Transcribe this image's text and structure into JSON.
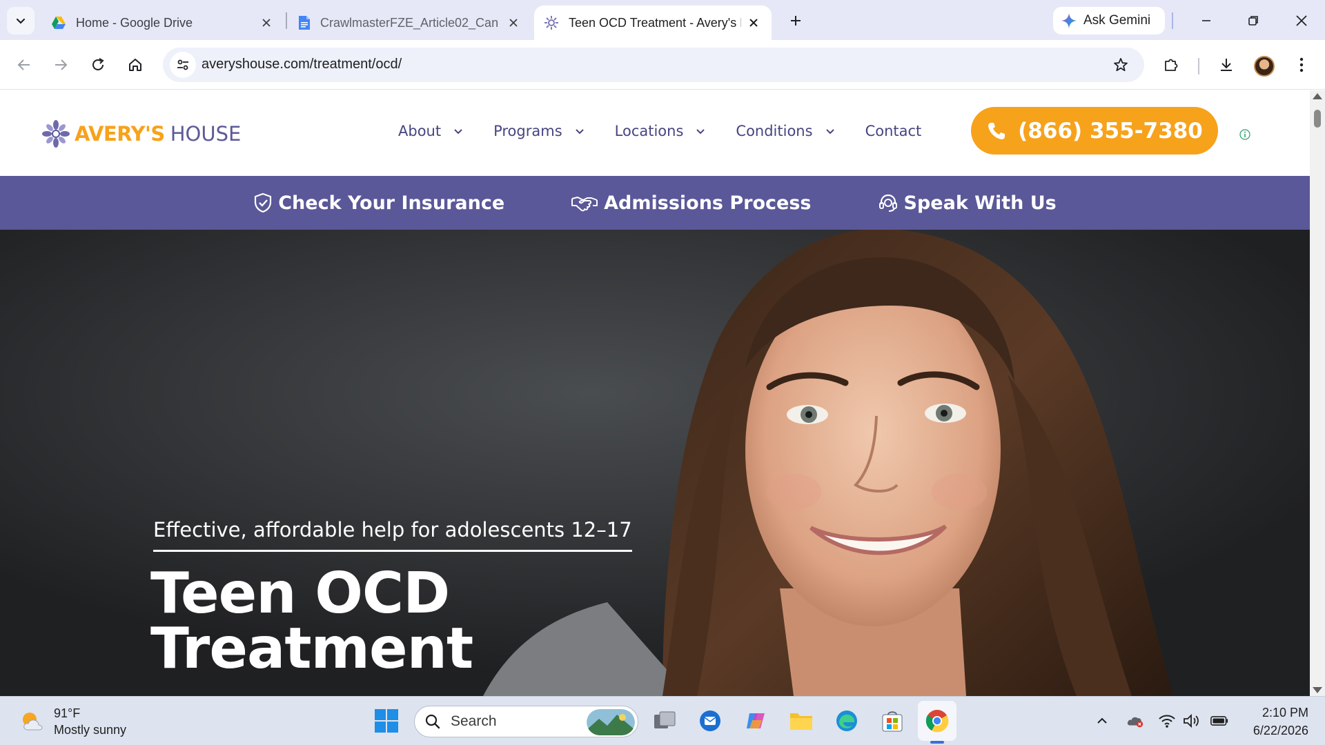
{
  "browser": {
    "tabs": [
      {
        "title": "Home - Google Drive",
        "icon": "google-drive-icon",
        "active": false
      },
      {
        "title": "CrawlmasterFZE_Article02_Can",
        "icon": "google-docs-icon",
        "active": false
      },
      {
        "title": "Teen OCD Treatment - Avery's H",
        "icon": "averys-house-favicon",
        "active": true
      }
    ],
    "ask_gemini_label": "Ask Gemini",
    "url": "averyshouse.com/treatment/ocd/"
  },
  "site": {
    "logo_word1": "AVERY'S",
    "logo_word2": "HOUSE",
    "nav": [
      {
        "label": "About",
        "dropdown": true
      },
      {
        "label": "Programs",
        "dropdown": true
      },
      {
        "label": "Locations",
        "dropdown": true
      },
      {
        "label": "Conditions",
        "dropdown": true
      },
      {
        "label": "Contact",
        "dropdown": false
      }
    ],
    "phone": "(866) 355-7380",
    "actions": [
      {
        "label": "Check Your Insurance",
        "icon": "shield-check-icon"
      },
      {
        "label": "Admissions Process",
        "icon": "handshake-icon"
      },
      {
        "label": "Speak With Us",
        "icon": "headset-icon"
      }
    ],
    "hero": {
      "tagline": "Effective, affordable help for adolescents 12–17",
      "title_line1": "Teen OCD",
      "title_line2": "Treatment"
    },
    "colors": {
      "accent": "#f7a21b",
      "brand_purple": "#5a5898",
      "nav_text": "#454580"
    }
  },
  "taskbar": {
    "weather_temp": "91°F",
    "weather_desc": "Mostly sunny",
    "search_placeholder": "Search",
    "time": "2:10 PM",
    "date": "6/22/2026"
  }
}
